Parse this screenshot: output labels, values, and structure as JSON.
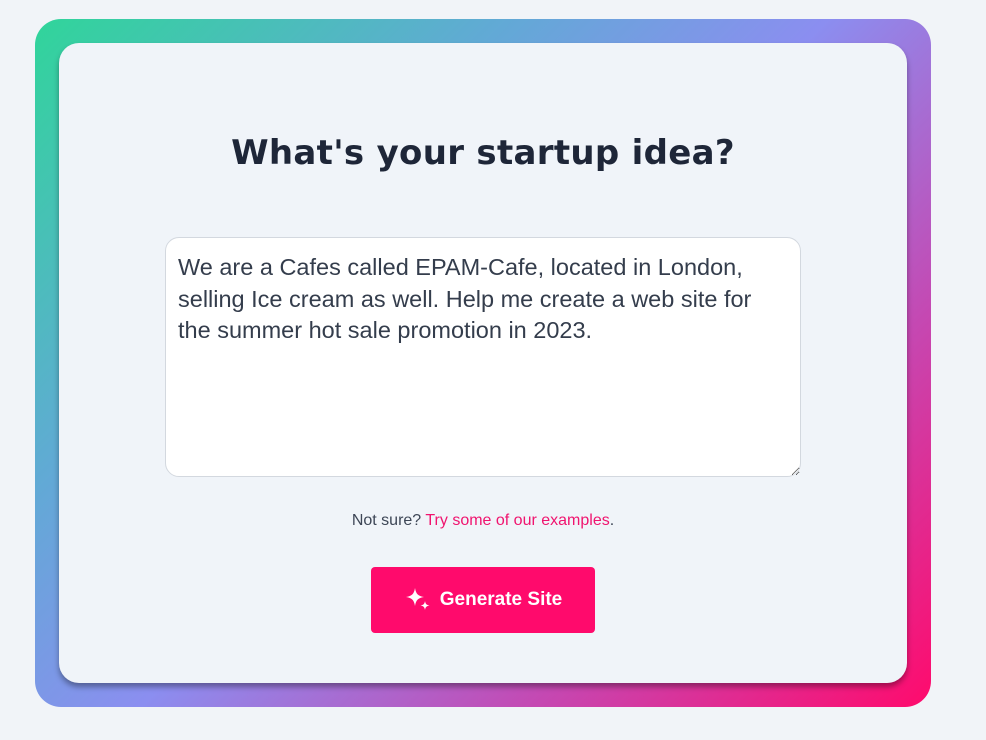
{
  "page": {
    "heading": "What's your startup idea?",
    "idea_input": {
      "value": "We are a Cafes called EPAM-Cafe, located in London, selling Ice cream as well. Help me create a web site for the summer hot sale promotion in 2023."
    },
    "hint": {
      "prefix": "Not sure? ",
      "link_text": "Try some of our examples",
      "suffix": "."
    },
    "generate_button": {
      "label": "Generate Site",
      "icon": "sparkle-icon"
    }
  },
  "colors": {
    "accent": "#ff0a6c",
    "frame_gradient": [
      "#30d59a",
      "#8b8ef0",
      "#ff0a6c"
    ],
    "card_background": "#f0f4f9",
    "heading_text": "#1e2638"
  }
}
